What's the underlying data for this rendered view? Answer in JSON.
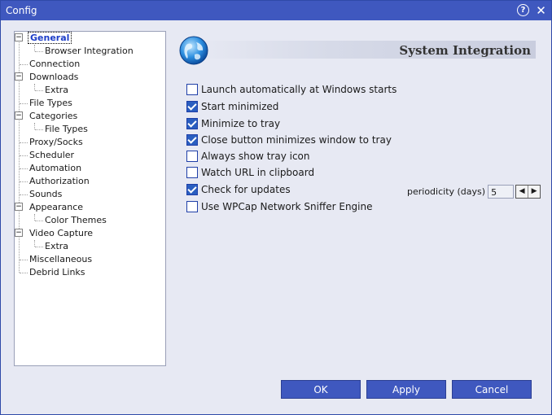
{
  "window": {
    "title": "Config"
  },
  "tree": {
    "items": [
      {
        "label": "General"
      },
      {
        "label": "Browser Integration"
      },
      {
        "label": "Connection"
      },
      {
        "label": "Downloads"
      },
      {
        "label": "Extra"
      },
      {
        "label": "File Types"
      },
      {
        "label": "Categories"
      },
      {
        "label": "File Types"
      },
      {
        "label": "Proxy/Socks"
      },
      {
        "label": "Scheduler"
      },
      {
        "label": "Automation"
      },
      {
        "label": "Authorization"
      },
      {
        "label": "Sounds"
      },
      {
        "label": "Appearance"
      },
      {
        "label": "Color Themes"
      },
      {
        "label": "Video Capture"
      },
      {
        "label": "Extra"
      },
      {
        "label": "Miscellaneous"
      },
      {
        "label": "Debrid Links"
      }
    ]
  },
  "section": {
    "title": "System Integration",
    "icon": "globe-icon"
  },
  "options": [
    {
      "label": "Launch automatically at Windows starts",
      "checked": false
    },
    {
      "label": "Start minimized",
      "checked": true
    },
    {
      "label": "Minimize to tray",
      "checked": true
    },
    {
      "label": "Close button minimizes window to tray",
      "checked": true
    },
    {
      "label": "Always show tray icon",
      "checked": false
    },
    {
      "label": "Watch URL in clipboard",
      "checked": false
    },
    {
      "label": "Check for updates",
      "checked": true
    },
    {
      "label": "Use WPCap Network Sniffer Engine",
      "checked": false
    }
  ],
  "periodicity": {
    "label": "periodicity (days)",
    "value": "5"
  },
  "buttons": {
    "ok": "OK",
    "apply": "Apply",
    "cancel": "Cancel"
  },
  "colors": {
    "titlebar": "#3f58bf",
    "button": "#3f58bf",
    "selected_text": "#1d3ec8"
  }
}
